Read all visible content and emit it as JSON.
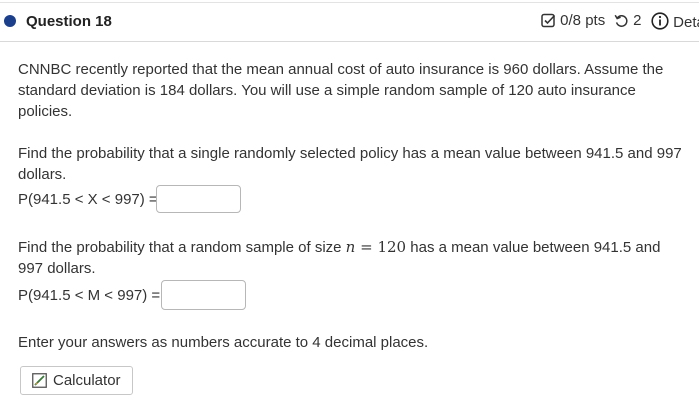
{
  "header": {
    "title": "Question 18",
    "points": "0/8 pts",
    "retries": "2",
    "details": "Details"
  },
  "problem": {
    "intro_line1": "CNNBC recently reported that the mean annual cost of auto insurance is 960 dollars. Assume the",
    "intro_line2": "standard deviation is 184 dollars. You will use a simple random sample of 120 auto insurance",
    "intro_line3": "policies.",
    "part1_line1": "Find the probability that a single randomly selected policy has a mean value between 941.5 and 997",
    "part1_line2": "dollars.",
    "part1_label": "P(941.5 < X < 997) =",
    "part1_value": "",
    "part2_line1_pre": "Find the probability that a random sample of size ",
    "part2_n": "n",
    "part2_eq": " = ",
    "part2_num": "120",
    "part2_line1_post": " has a mean value between 941.5 and",
    "part2_line2": "997 dollars.",
    "part2_label": "P(941.5 < M < 997) =",
    "part2_value": "",
    "instructions": "Enter your answers as numbers accurate to 4 decimal places."
  },
  "calculator": {
    "label": "Calculator"
  }
}
